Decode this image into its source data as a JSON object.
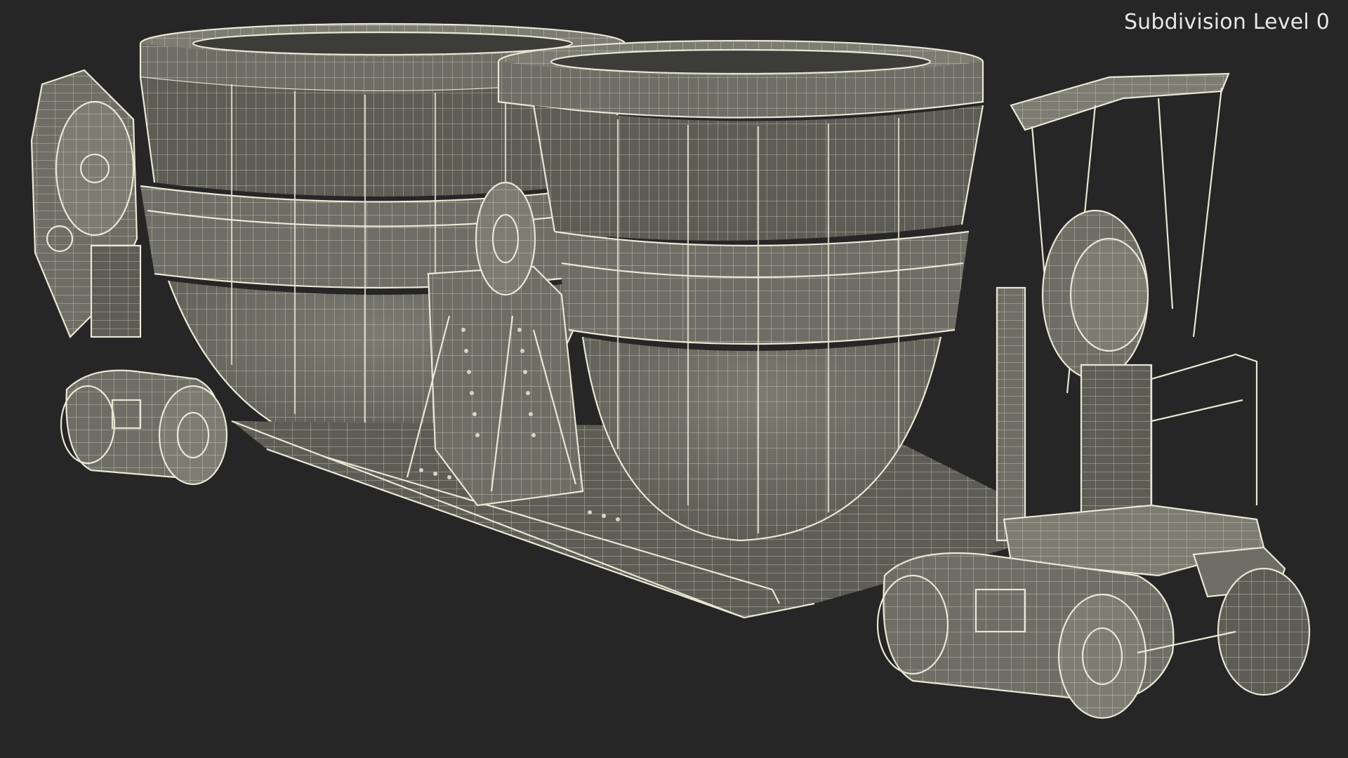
{
  "viewport": {
    "label": "Subdivision Level 0",
    "background": "#262626",
    "wire_color": "#e9e7d5",
    "surface_color": "#6e6e66"
  },
  "scene": {
    "object": "rail-car-with-two-ladles",
    "style": "wireframe-over-shaded"
  }
}
